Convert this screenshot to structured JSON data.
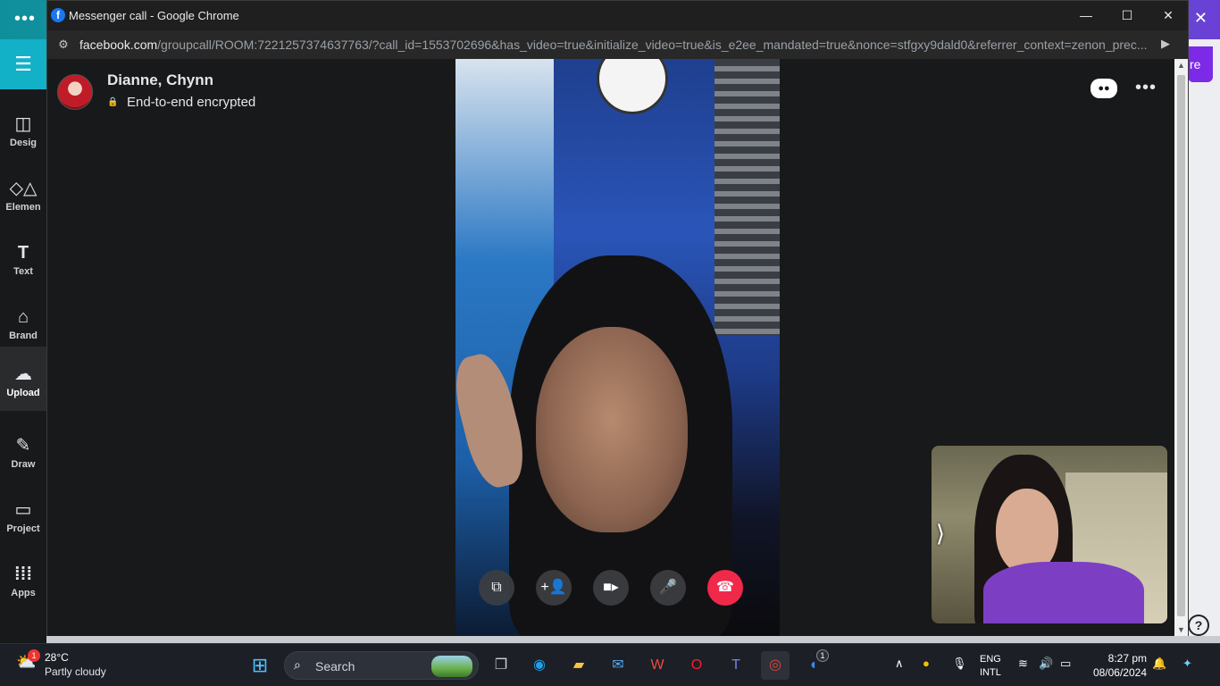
{
  "background_app": {
    "sidebar_items": [
      {
        "label": "Design",
        "icon": "layout-icon"
      },
      {
        "label": "Elements",
        "icon": "shapes-icon"
      },
      {
        "label": "Text",
        "icon": "text-icon"
      },
      {
        "label": "Brand",
        "icon": "brand-icon"
      },
      {
        "label": "Uploads",
        "icon": "upload-cloud-icon"
      },
      {
        "label": "Draw",
        "icon": "pen-icon"
      },
      {
        "label": "Projects",
        "icon": "folder-icon"
      },
      {
        "label": "Apps",
        "icon": "grid-icon"
      }
    ],
    "sidebar_visible_labels": [
      "Desig",
      "Elemen",
      "Text",
      "Brand",
      "Upload",
      "Draw",
      "Project",
      "Apps"
    ],
    "right_button_label": "re",
    "help_label": "?"
  },
  "window": {
    "title": "Messenger call - Google Chrome",
    "url_host": "facebook.com",
    "url_path": "/groupcall/ROOM:7221257374637763/?call_id=1553702696&has_video=true&initialize_video=true&is_e2ee_mandated=true&nonce=stfgxy9dald0&referrer_context=zenon_prec..."
  },
  "call": {
    "name": "Dianne, Chynn",
    "encryption": "End-to-end encrypted",
    "controls": [
      {
        "name": "share-screen-button",
        "icon": "screen-share-icon"
      },
      {
        "name": "add-people-button",
        "icon": "add-person-icon"
      },
      {
        "name": "camera-button",
        "icon": "video-camera-icon"
      },
      {
        "name": "microphone-button",
        "icon": "microphone-icon"
      },
      {
        "name": "end-call-button",
        "icon": "phone-hangup-icon"
      }
    ],
    "end_call_color": "#f0284a"
  },
  "taskbar": {
    "weather_badge": "1",
    "temperature": "28°C",
    "condition": "Partly cloudy",
    "search_label": "Search",
    "language_line1": "ENG",
    "language_line2": "INTL",
    "time": "8:27 pm",
    "date": "08/06/2024",
    "messenger_badge": "1"
  }
}
